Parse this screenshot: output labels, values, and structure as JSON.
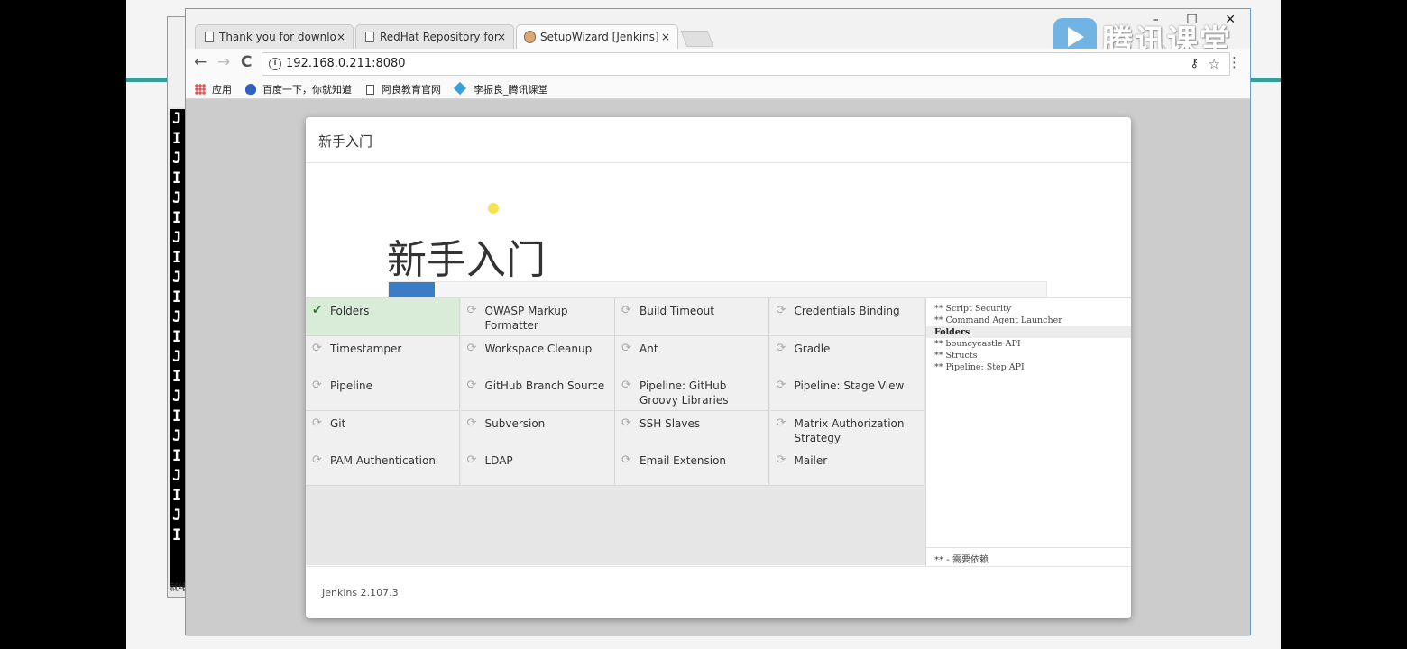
{
  "terminal": {
    "lines": [
      "J",
      "I",
      "J",
      "I",
      "J",
      "I",
      "J",
      "I",
      "J",
      "I",
      "J",
      "I",
      "J",
      "I",
      "J",
      "I",
      "J",
      "I",
      "J",
      "I",
      "J",
      "I"
    ],
    "status": "就绪"
  },
  "browser": {
    "tabs": [
      {
        "title": "Thank you for downlo",
        "close": "×"
      },
      {
        "title": "RedHat Repository for",
        "close": "×"
      },
      {
        "title": "SetupWizard [Jenkins]",
        "close": "×"
      }
    ],
    "window_controls": {
      "minimize": "–",
      "maximize": "☐",
      "close": "✕"
    },
    "watermark": "腾讯课堂",
    "url": "192.168.0.211:8080",
    "nav": {
      "back": "←",
      "forward": "→",
      "reload": "C"
    },
    "bookmarks": [
      {
        "label": "应用",
        "icon": "apps-icon"
      },
      {
        "label": "百度一下，你就知道",
        "icon": "paw-icon"
      },
      {
        "label": "阿良教育官网",
        "icon": "document-icon"
      },
      {
        "label": "李振良_腾讯课堂",
        "icon": "diamond-icon"
      }
    ]
  },
  "wizard": {
    "header_title": "新手入门",
    "hero_title": "新手入门",
    "progress": 0.07,
    "plugins": [
      {
        "name": "Folders",
        "status": "done"
      },
      {
        "name": "OWASP Markup Formatter",
        "status": "pending"
      },
      {
        "name": "Build Timeout",
        "status": "pending"
      },
      {
        "name": "Credentials Binding",
        "status": "pending"
      },
      {
        "name": "Timestamper",
        "status": "pending"
      },
      {
        "name": "Workspace Cleanup",
        "status": "pending"
      },
      {
        "name": "Ant",
        "status": "pending"
      },
      {
        "name": "Gradle",
        "status": "pending"
      },
      {
        "name": "Pipeline",
        "status": "pending"
      },
      {
        "name": "GitHub Branch Source",
        "status": "pending"
      },
      {
        "name": "Pipeline: GitHub Groovy Libraries",
        "status": "pending"
      },
      {
        "name": "Pipeline: Stage View",
        "status": "pending"
      },
      {
        "name": "Git",
        "status": "pending"
      },
      {
        "name": "Subversion",
        "status": "pending"
      },
      {
        "name": "SSH Slaves",
        "status": "pending"
      },
      {
        "name": "Matrix Authorization Strategy",
        "status": "pending"
      },
      {
        "name": "PAM Authentication",
        "status": "pending"
      },
      {
        "name": "LDAP",
        "status": "pending"
      },
      {
        "name": "Email Extension",
        "status": "pending"
      },
      {
        "name": "Mailer",
        "status": "pending"
      }
    ],
    "log": [
      {
        "text": "** Script Security",
        "highlight": false
      },
      {
        "text": "** Command Agent Launcher",
        "highlight": false
      },
      {
        "text": "Folders",
        "highlight": true
      },
      {
        "text": "** bouncycastle API",
        "highlight": false
      },
      {
        "text": "** Structs",
        "highlight": false
      },
      {
        "text": "** Pipeline: Step API",
        "highlight": false
      }
    ],
    "log_footer": "** - 需要依赖",
    "version": "Jenkins 2.107.3"
  }
}
